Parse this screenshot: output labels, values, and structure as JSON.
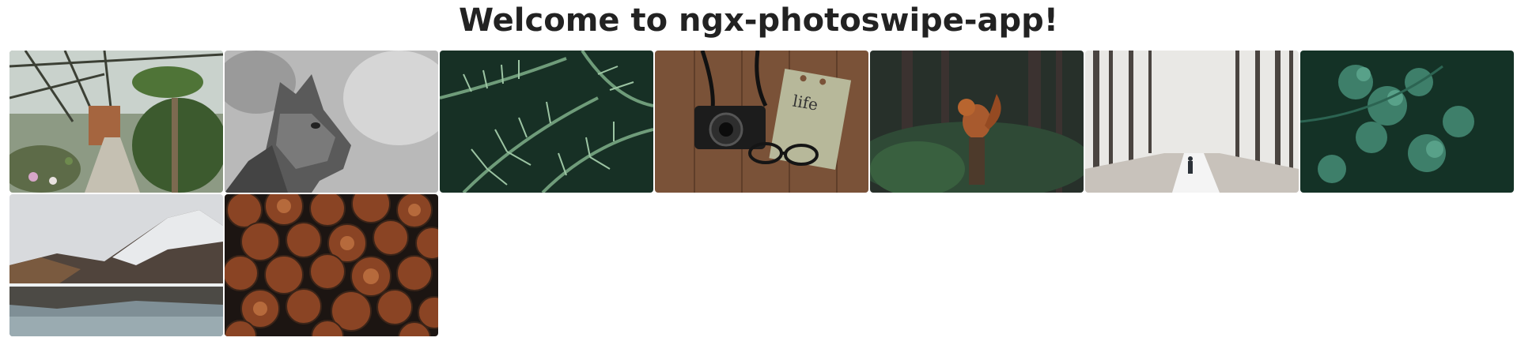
{
  "page": {
    "title": "Welcome to ngx-photoswipe-app!"
  },
  "gallery": {
    "images": [
      {
        "subject": "greenhouse-with-cacti-and-palms"
      },
      {
        "subject": "black-and-white-cat-profile"
      },
      {
        "subject": "fern-leaves"
      },
      {
        "subject": "camera-glasses-and-notebook-on-wood"
      },
      {
        "subject": "squirrel-in-forest"
      },
      {
        "subject": "person-walking-snowy-forest-path"
      },
      {
        "subject": "green-parsley-leaves"
      },
      {
        "subject": "mountain-lake-reflection"
      },
      {
        "subject": "stacked-firewood-logs"
      }
    ],
    "notebook_text": "life"
  }
}
